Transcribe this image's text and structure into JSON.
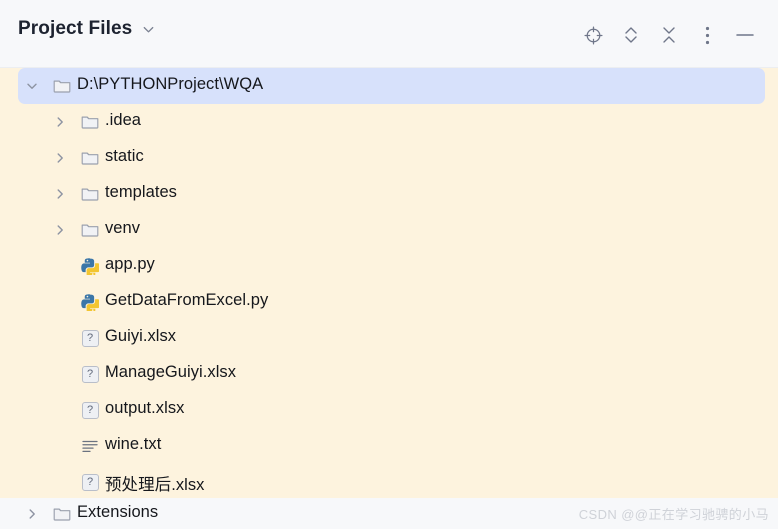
{
  "window": {
    "title": "Project Files",
    "title_caret_icon": "chevron-down-icon"
  },
  "toolbar": {
    "buttons": [
      {
        "name": "locate-target-icon",
        "label": "Select Opened File",
        "icon": "crosshair-target-icon"
      },
      {
        "name": "expand-all-icon",
        "label": "Expand All",
        "icon": "chevron-up-down-icon"
      },
      {
        "name": "collapse-all-icon",
        "label": "Collapse All",
        "icon": "chevron-down-up-icon"
      },
      {
        "name": "more-options-icon",
        "label": "Options",
        "icon": "vertical-dots-icon"
      },
      {
        "name": "minimize-icon",
        "label": "Hide",
        "icon": "minus-icon"
      }
    ]
  },
  "tree": {
    "items": [
      {
        "label": "D:\\PYTHONProject\\WQA",
        "icon": "folder-icon",
        "depth": 0,
        "expandable": true,
        "expanded": true,
        "selected": true
      },
      {
        "label": ".idea",
        "icon": "folder-icon",
        "depth": 1,
        "expandable": true,
        "expanded": false,
        "selected": false
      },
      {
        "label": "static",
        "icon": "folder-icon",
        "depth": 1,
        "expandable": true,
        "expanded": false,
        "selected": false
      },
      {
        "label": "templates",
        "icon": "folder-icon",
        "depth": 1,
        "expandable": true,
        "expanded": false,
        "selected": false
      },
      {
        "label": "venv",
        "icon": "folder-icon",
        "depth": 1,
        "expandable": true,
        "expanded": false,
        "selected": false
      },
      {
        "label": "app.py",
        "icon": "python-file-icon",
        "depth": 1,
        "expandable": false,
        "expanded": false,
        "selected": false
      },
      {
        "label": "GetDataFromExcel.py",
        "icon": "python-file-icon",
        "depth": 1,
        "expandable": false,
        "expanded": false,
        "selected": false
      },
      {
        "label": "Guiyi.xlsx",
        "icon": "unknown-file-icon",
        "depth": 1,
        "expandable": false,
        "expanded": false,
        "selected": false
      },
      {
        "label": "ManageGuiyi.xlsx",
        "icon": "unknown-file-icon",
        "depth": 1,
        "expandable": false,
        "expanded": false,
        "selected": false
      },
      {
        "label": "output.xlsx",
        "icon": "unknown-file-icon",
        "depth": 1,
        "expandable": false,
        "expanded": false,
        "selected": false
      },
      {
        "label": "wine.txt",
        "icon": "text-file-icon",
        "depth": 1,
        "expandable": false,
        "expanded": false,
        "selected": false
      },
      {
        "label": "预处理后.xlsx",
        "icon": "unknown-file-icon",
        "depth": 1,
        "expandable": false,
        "expanded": false,
        "selected": false
      }
    ]
  },
  "bottom_section": {
    "items": [
      {
        "label": "Extensions",
        "icon": "folder-icon",
        "depth": 0,
        "expandable": true,
        "expanded": false,
        "selected": false
      }
    ]
  },
  "watermark": {
    "text": "CSDN @@正在学习驰骋的小马"
  },
  "colors": {
    "header_bg": "#f7f8fa",
    "tree_bg": "#fdf3de",
    "selected_row_bg": "#d7e1fb",
    "text": "#15171c",
    "icon_gray": "#6f7689",
    "python_blue": "#3b76a8",
    "python_yellow": "#f2c531"
  },
  "unknown_icon_glyph": "?"
}
